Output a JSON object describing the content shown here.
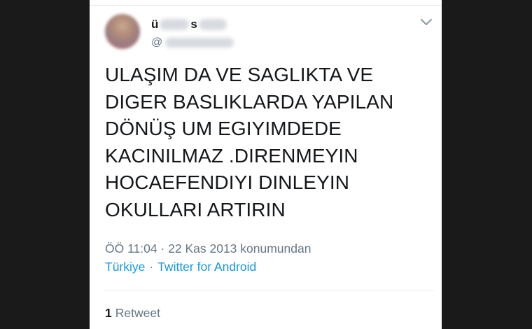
{
  "tweet": {
    "author": {
      "name_visible_start": "ü",
      "name_visible_mid": "s",
      "handle_prefix": "@"
    },
    "text": "ULAŞIM DA VE SAGLIKTA VE\nDIGER BASLIKLARDA YAPILAN\nDÖNÜŞ UM EGIYIMDEDE\nKACINILMAZ .DIRENMEYIN\nHOCAEFENDIYI DINLEYIN\nOKULLARI ARTIRIN",
    "timestamp": "ÖÖ 11:04 · 22 Kas 2013 konumundan",
    "location": "Türkiye",
    "separator": "·",
    "source": "Twitter for Android",
    "retweet_count": "1",
    "retweet_label": "Retweet"
  },
  "colors": {
    "text_primary": "#14171a",
    "text_secondary": "#657786",
    "link": "#1b95e0",
    "background_outer": "#1a1a1a",
    "card": "#ffffff"
  },
  "icons": {
    "caret": "chevron-down-icon"
  }
}
